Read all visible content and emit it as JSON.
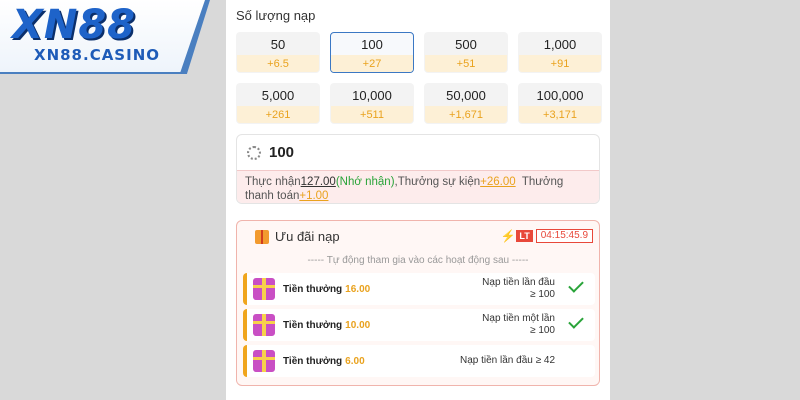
{
  "logo": {
    "main": "XN88",
    "sub": "XN88.CASINO"
  },
  "deposit": {
    "section_title": "Số lượng nạp",
    "amounts": [
      {
        "value": "50",
        "bonus": "+6.5",
        "selected": false
      },
      {
        "value": "100",
        "bonus": "+27",
        "selected": true
      },
      {
        "value": "500",
        "bonus": "+51",
        "selected": false
      },
      {
        "value": "1,000",
        "bonus": "+91",
        "selected": false
      },
      {
        "value": "5,000",
        "bonus": "+261",
        "selected": false
      },
      {
        "value": "10,000",
        "bonus": "+511",
        "selected": false
      },
      {
        "value": "50,000",
        "bonus": "+1,671",
        "selected": false
      },
      {
        "value": "100,000",
        "bonus": "+3,171",
        "selected": false
      }
    ],
    "input_value": "100",
    "info": {
      "receive_label": "Thực nhận",
      "receive_value": "127.00",
      "remember": "(Nhớ nhận)",
      "event_label": ",Thưởng sự kiện",
      "event_value": "+26.00",
      "pay_label": "Thưởng thanh toán",
      "pay_value": "+1.00"
    }
  },
  "promo": {
    "title": "Ưu đãi nạp",
    "lt_label": "LT",
    "timer": "04:15:45.9",
    "subtitle": "----- Tự động tham gia vào các hoạt động sau -----",
    "rows": [
      {
        "label": "Tiền thưởng",
        "amount": "16.00",
        "cond_line1": "Nạp tiền lần đầu",
        "cond_line2": "≥ 100",
        "checked": true
      },
      {
        "label": "Tiền thưởng",
        "amount": "10.00",
        "cond_line1": "Nạp tiền một lần",
        "cond_line2": "≥ 100",
        "checked": true
      },
      {
        "label": "Tiền thưởng",
        "amount": "6.00",
        "cond_line1": "Nạp tiền lần đầu ≥ 42",
        "cond_line2": "",
        "checked": false
      }
    ]
  },
  "colors": {
    "accent": "#3b78c4",
    "bonus": "#e9a21e",
    "success": "#2aa43a",
    "alert": "#e8483a"
  }
}
